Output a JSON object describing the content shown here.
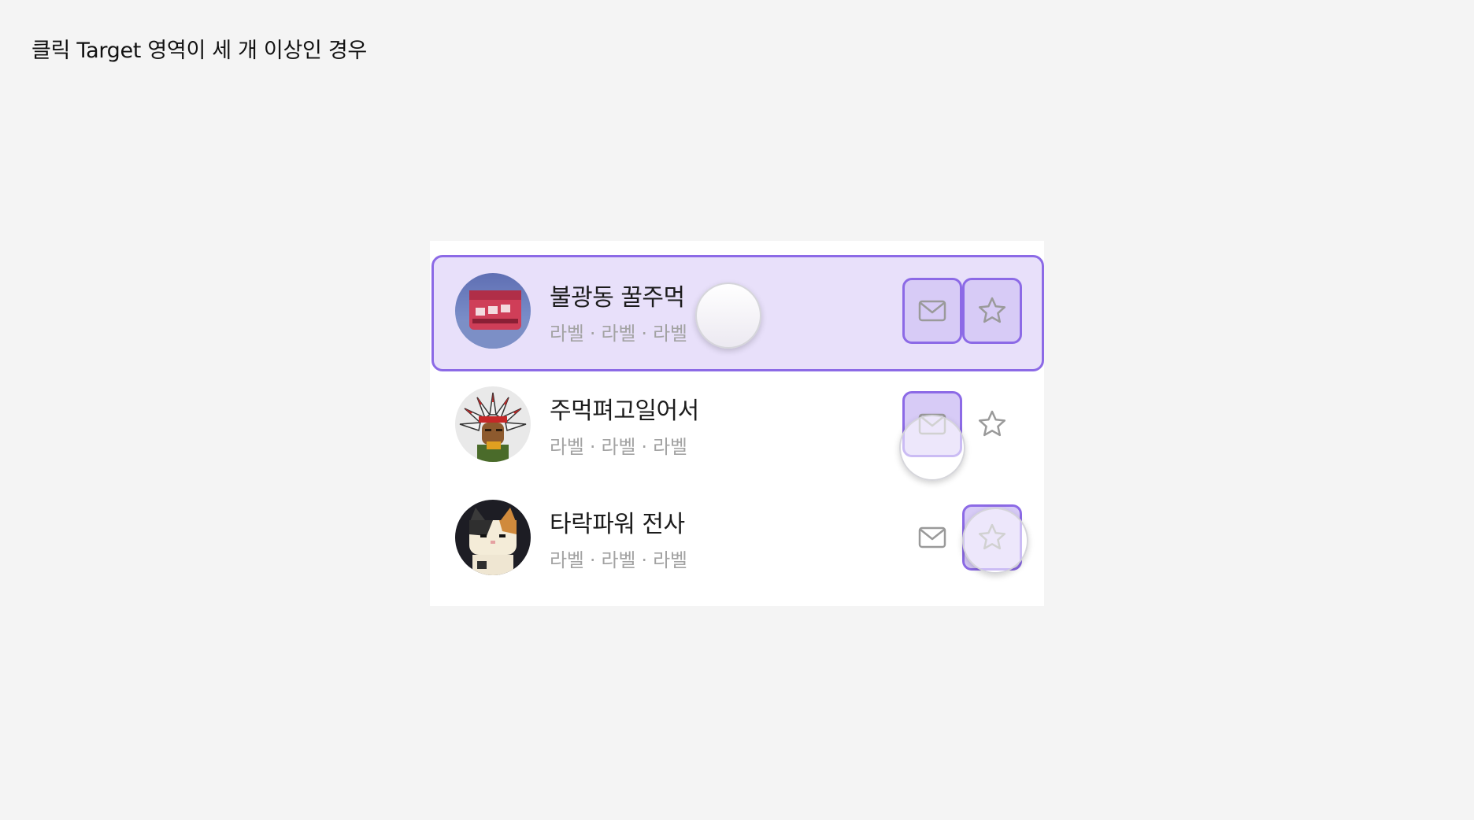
{
  "page": {
    "title": "클릭 Target 영역이 세 개 이상인 경우"
  },
  "colors": {
    "accent": "#8c6ae6",
    "highlight": "#e8e0fa",
    "icon": "#9a9a9a"
  },
  "list": {
    "items": [
      {
        "name": "불광동 꿀주먹",
        "sub": "라벨 · 라벨 · 라벨",
        "state": "row-pressed",
        "mail_icon": "mail-icon",
        "star_icon": "star-icon"
      },
      {
        "name": "주먹펴고일어서",
        "sub": "라벨 · 라벨 · 라벨",
        "state": "mail-pressed",
        "mail_icon": "mail-icon",
        "star_icon": "star-icon"
      },
      {
        "name": "타락파워 전사",
        "sub": "라벨 · 라벨 · 라벨",
        "state": "star-pressed",
        "mail_icon": "mail-icon",
        "star_icon": "star-icon"
      }
    ]
  }
}
